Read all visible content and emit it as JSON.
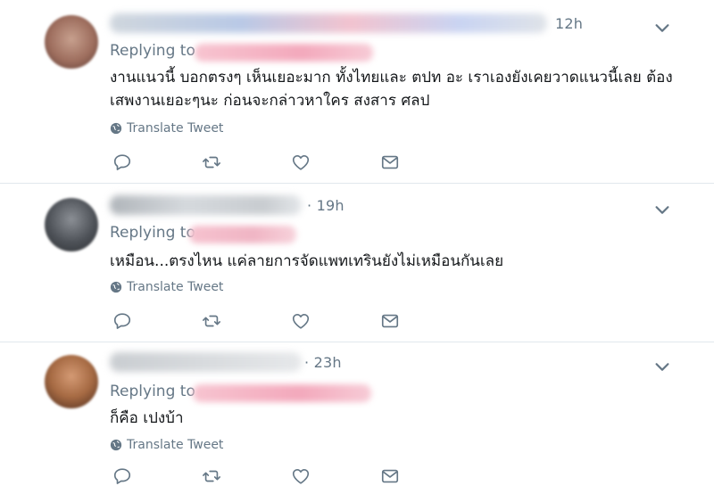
{
  "tweets": [
    {
      "time": "12h",
      "replying_label": "Replying to",
      "lines": [
        "งานแนวนี้ บอกตรงๆ เห็นเยอะมาก ทั้งไทยและ ตปท อะ เราเองยังเคยวาดแนวนี้เลย ต้อง",
        "เสพงานเยอะๆนะ ก่อนจะกล่าวหาใคร สงสาร ศลป"
      ],
      "translate": "Translate Tweet"
    },
    {
      "time": "19h",
      "replying_label": "Replying to",
      "lines": [
        "เหมือน...ตรงไหน แค่ลายการจัดแพทเทรินยังไม่เหมือนกันเลย"
      ],
      "translate": "Translate Tweet"
    },
    {
      "time": "23h",
      "replying_label": "Replying to",
      "lines": [
        "ก็คือ เปงบ้า"
      ],
      "translate": "Translate Tweet"
    }
  ],
  "icons": [
    "globe-icon",
    "reply-icon",
    "retweet-icon",
    "like-icon",
    "message-icon",
    "chevron-down-icon"
  ],
  "colors": {
    "muted": "#657786",
    "text": "#14171a",
    "divider": "#e1e8ed",
    "redacted_pink": "#f7b9c8"
  }
}
